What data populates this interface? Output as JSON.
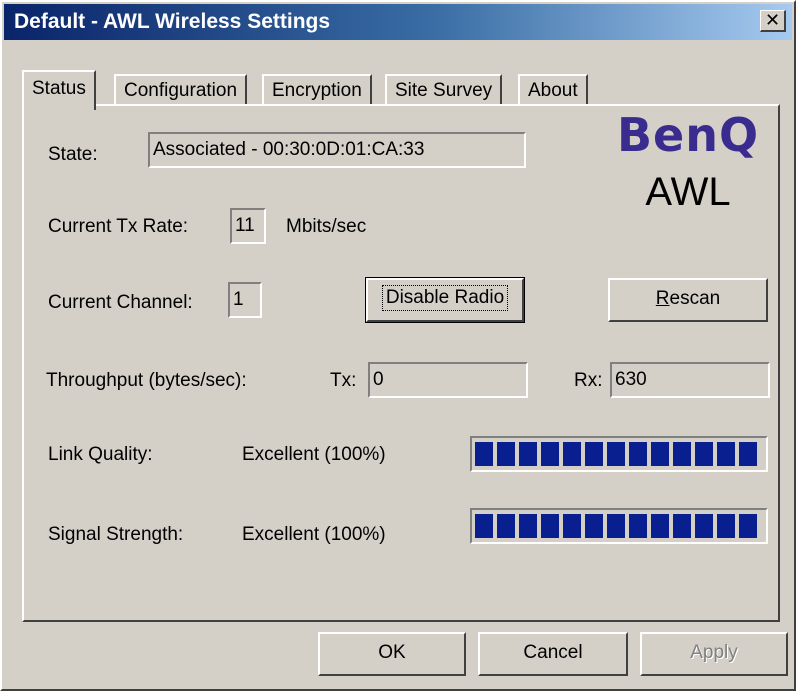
{
  "window": {
    "title": "Default - AWL Wireless Settings",
    "close_glyph": "✕"
  },
  "tabs": [
    {
      "label": "Status",
      "active": true
    },
    {
      "label": "Configuration",
      "active": false
    },
    {
      "label": "Encryption",
      "active": false
    },
    {
      "label": "Site Survey",
      "active": false
    },
    {
      "label": "About",
      "active": false
    }
  ],
  "logo": {
    "brand": "BenQ",
    "product": "AWL"
  },
  "status": {
    "state_label": "State:",
    "state_value": "Associated - 00:30:0D:01:CA:33",
    "tx_rate_label": "Current Tx Rate:",
    "tx_rate_value": "11",
    "tx_rate_unit": "Mbits/sec",
    "channel_label": "Current Channel:",
    "channel_value": "1",
    "disable_radio_label": "Disable Radio",
    "rescan_label_rest": "escan",
    "rescan_label_key": "R",
    "throughput_label": "Throughput (bytes/sec):",
    "tx_label": "Tx:",
    "tx_value": "0",
    "rx_label": "Rx:",
    "rx_value": "630",
    "link_quality_label": "Link Quality:",
    "link_quality_value": "Excellent (100%)",
    "link_quality_percent": 100,
    "signal_strength_label": "Signal Strength:",
    "signal_strength_value": "Excellent (100%)",
    "signal_strength_percent": 100
  },
  "footer": {
    "ok_label": "OK",
    "cancel_label": "Cancel",
    "apply_label": "Apply",
    "apply_enabled": false
  },
  "colors": {
    "bar_fill": "#0a1f8f",
    "logo_brand": "#3a2b8f",
    "title_bar": "#0a246a"
  }
}
